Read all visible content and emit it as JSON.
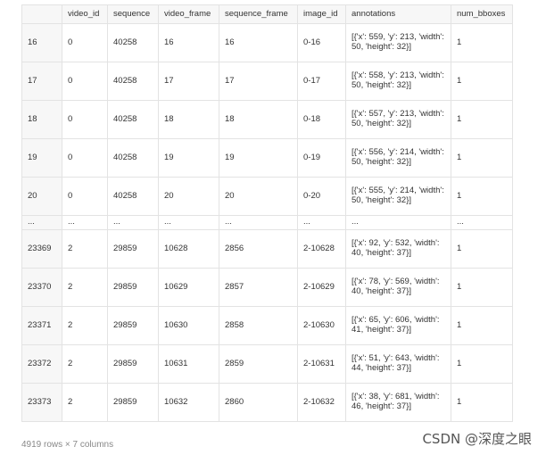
{
  "table": {
    "columns": [
      "",
      "video_id",
      "sequence",
      "video_frame",
      "sequence_frame",
      "image_id",
      "annotations",
      "num_bboxes"
    ],
    "rows": [
      [
        "16",
        "0",
        "40258",
        "16",
        "16",
        "0-16",
        "[{'x': 559, 'y': 213, 'width': 50, 'height': 32}]",
        "1"
      ],
      [
        "17",
        "0",
        "40258",
        "17",
        "17",
        "0-17",
        "[{'x': 558, 'y': 213, 'width': 50, 'height': 32}]",
        "1"
      ],
      [
        "18",
        "0",
        "40258",
        "18",
        "18",
        "0-18",
        "[{'x': 557, 'y': 213, 'width': 50, 'height': 32}]",
        "1"
      ],
      [
        "19",
        "0",
        "40258",
        "19",
        "19",
        "0-19",
        "[{'x': 556, 'y': 214, 'width': 50, 'height': 32}]",
        "1"
      ],
      [
        "20",
        "0",
        "40258",
        "20",
        "20",
        "0-20",
        "[{'x': 555, 'y': 214, 'width': 50, 'height': 32}]",
        "1"
      ],
      [
        "...",
        "...",
        "...",
        "...",
        "...",
        "...",
        "...",
        "..."
      ],
      [
        "23369",
        "2",
        "29859",
        "10628",
        "2856",
        "2-10628",
        "[{'x': 92, 'y': 532, 'width': 40, 'height': 37}]",
        "1"
      ],
      [
        "23370",
        "2",
        "29859",
        "10629",
        "2857",
        "2-10629",
        "[{'x': 78, 'y': 569, 'width': 40, 'height': 37}]",
        "1"
      ],
      [
        "23371",
        "2",
        "29859",
        "10630",
        "2858",
        "2-10630",
        "[{'x': 65, 'y': 606, 'width': 41, 'height': 37}]",
        "1"
      ],
      [
        "23372",
        "2",
        "29859",
        "10631",
        "2859",
        "2-10631",
        "[{'x': 51, 'y': 643, 'width': 44, 'height': 37}]",
        "1"
      ],
      [
        "23373",
        "2",
        "29859",
        "10632",
        "2860",
        "2-10632",
        "[{'x': 38, 'y': 681, 'width': 46, 'height': 37}]",
        "1"
      ]
    ]
  },
  "footer": {
    "shape_text": "4919 rows × 7 columns"
  },
  "watermark": {
    "text": "CSDN @深度之眼"
  }
}
